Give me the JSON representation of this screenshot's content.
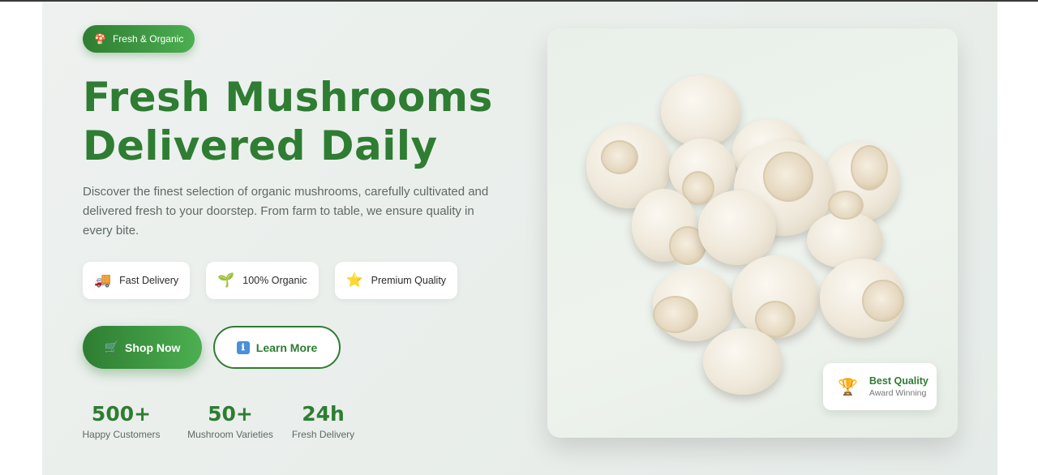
{
  "hero": {
    "badge": {
      "icon": "🍄",
      "label": "Fresh & Organic"
    },
    "headline": {
      "line1": "Fresh Mushrooms",
      "line2": "Delivered Daily"
    },
    "description": "Discover the finest selection of organic mushrooms, carefully cultivated and delivered fresh to your doorstep. From farm to table, we ensure quality in every bite.",
    "features": [
      {
        "icon": "🚚",
        "label": "Fast Delivery"
      },
      {
        "icon": "🌱",
        "label": "100% Organic"
      },
      {
        "icon": "⭐",
        "label": "Premium Quality"
      }
    ],
    "actions": {
      "primary": {
        "icon": "🛒",
        "label": "Shop Now"
      },
      "secondary": {
        "icon": "ℹ",
        "label": "Learn More"
      }
    },
    "stats": [
      {
        "value": "500+",
        "label": "Happy Customers"
      },
      {
        "value": "50+",
        "label": "Mushroom Varieties"
      },
      {
        "value": "24h",
        "label": "Fresh Delivery"
      }
    ],
    "quality_card": {
      "icon": "🏆",
      "title": "Best Quality",
      "subtitle": "Award Winning"
    }
  },
  "colors": {
    "brand": "#2e7d32",
    "brand_light": "#4caf50",
    "text_muted": "#5f6a65"
  }
}
